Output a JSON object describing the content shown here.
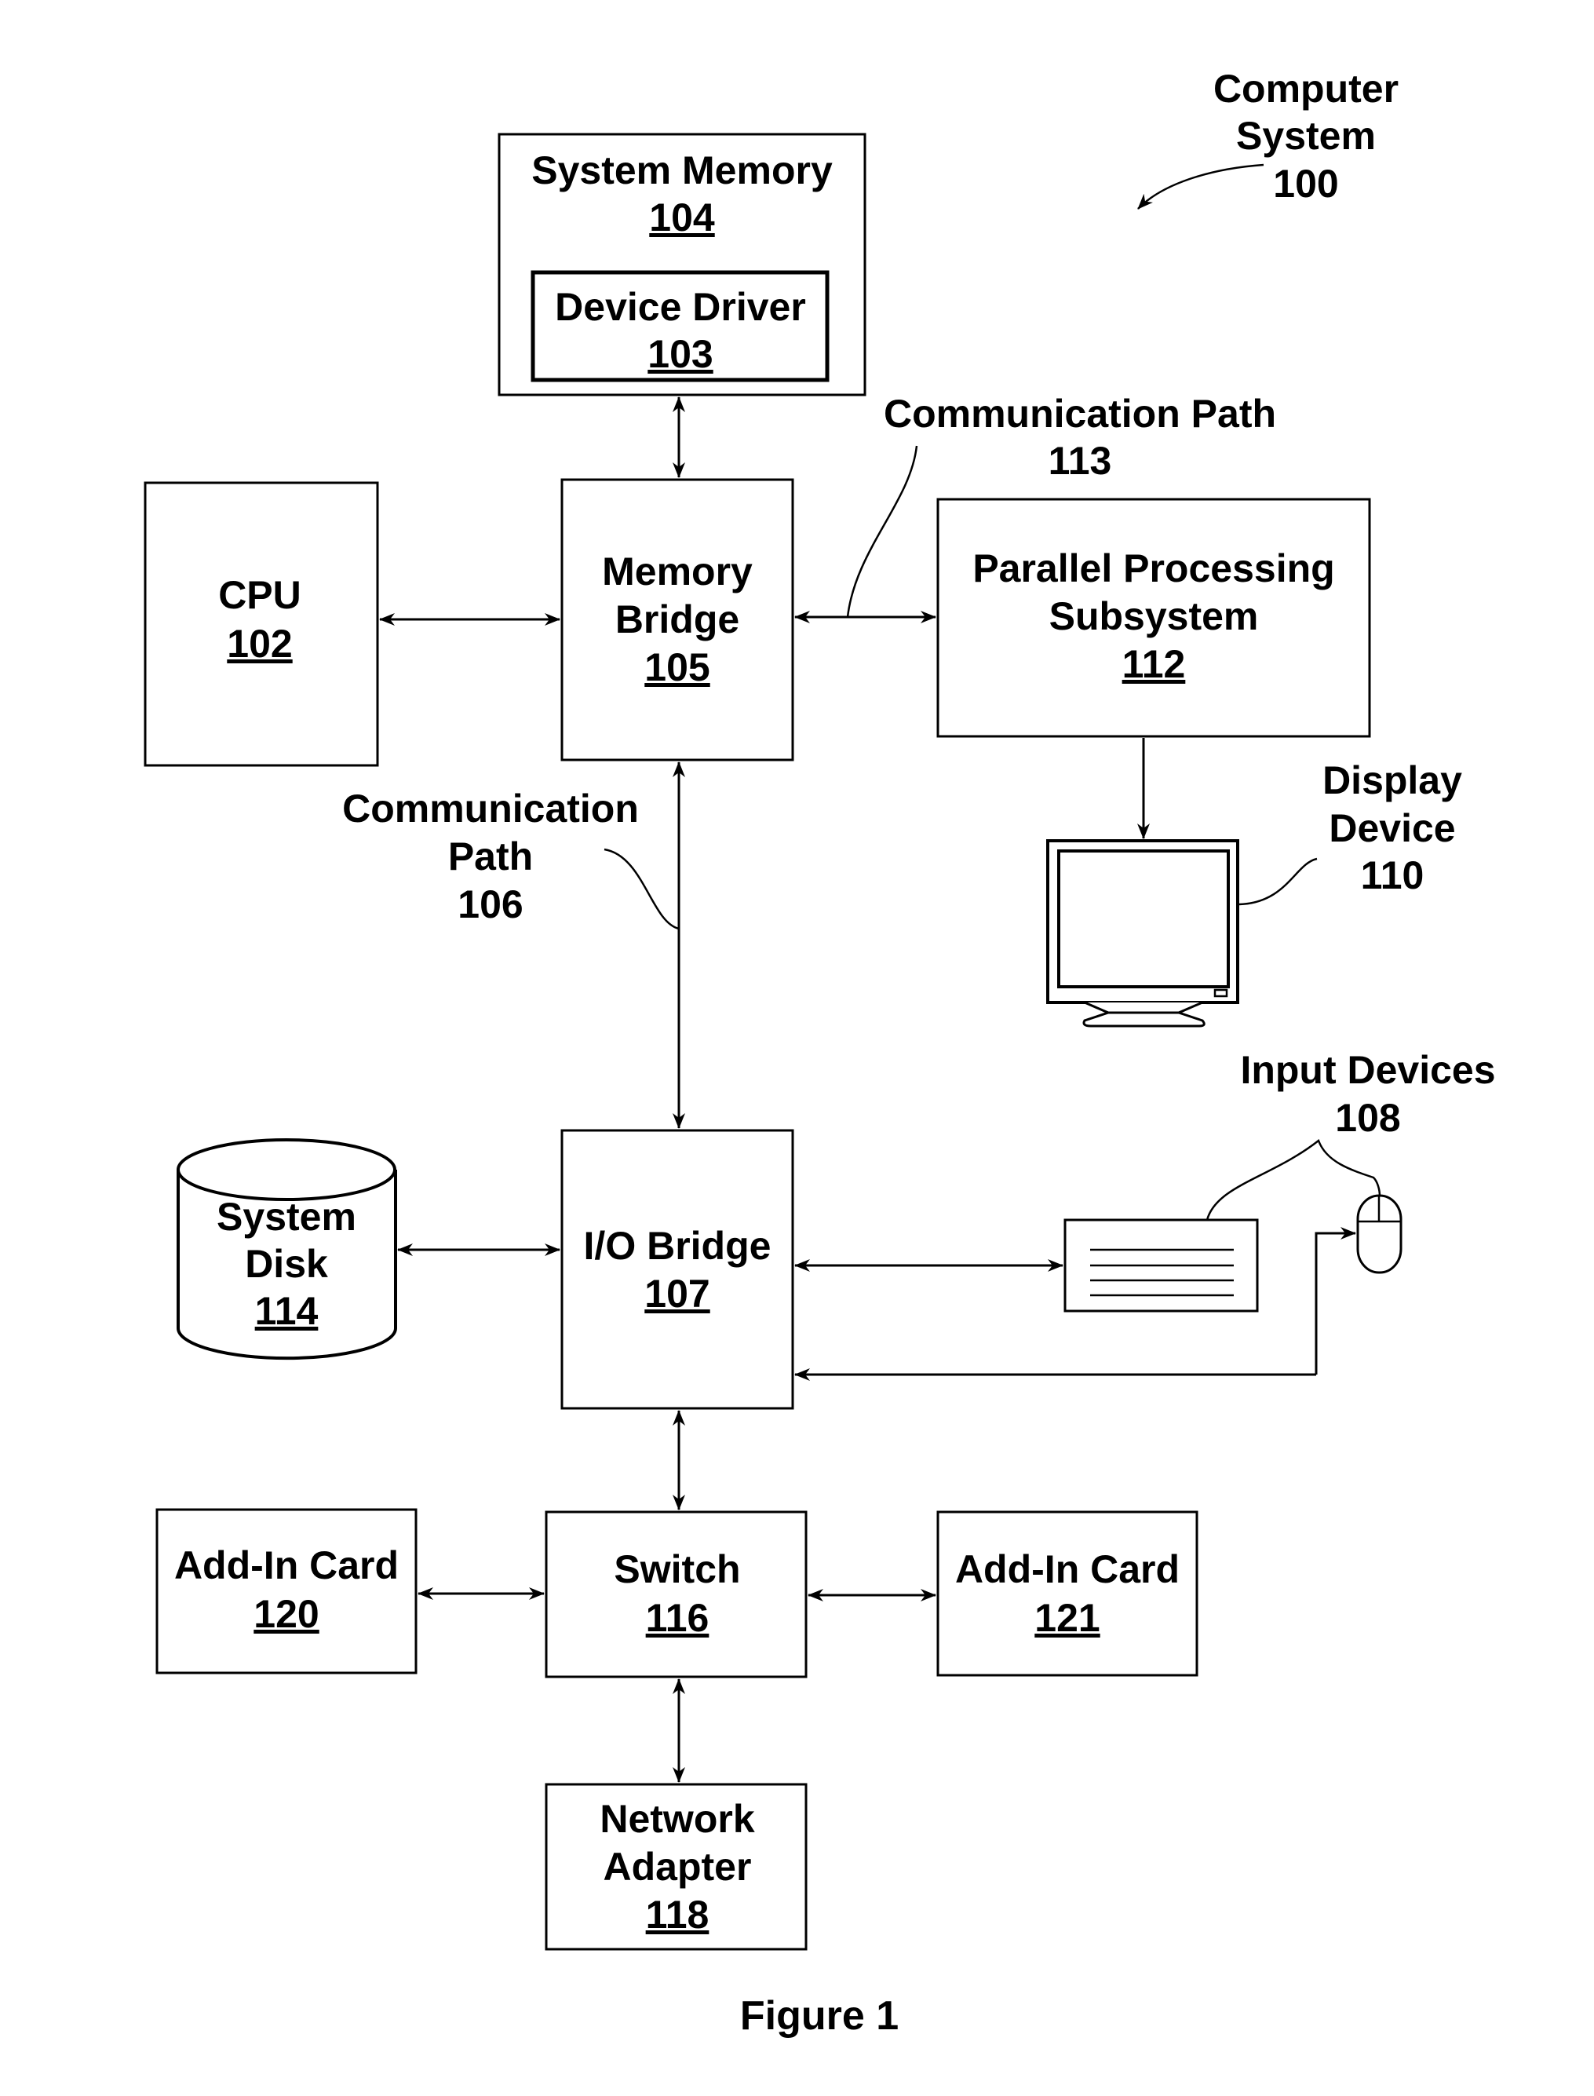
{
  "figure": {
    "caption": "Figure 1",
    "system_label": [
      "Computer",
      "System",
      "100"
    ]
  },
  "blocks": {
    "system_memory": {
      "name": "System Memory",
      "ref": "104"
    },
    "device_driver": {
      "name": "Device Driver",
      "ref": "103"
    },
    "cpu": {
      "name": "CPU",
      "ref": "102"
    },
    "memory_bridge": {
      "name": [
        "Memory",
        "Bridge"
      ],
      "ref": "105"
    },
    "parallel_processing": {
      "name": [
        "Parallel Processing",
        "Subsystem"
      ],
      "ref": "112"
    },
    "display_device": {
      "name": [
        "Display",
        "Device"
      ],
      "ref": "110"
    },
    "io_bridge": {
      "name": "I/O Bridge",
      "ref": "107"
    },
    "system_disk": {
      "name": [
        "System",
        "Disk"
      ],
      "ref": "114"
    },
    "input_devices": {
      "name": "Input Devices",
      "ref": "108"
    },
    "switch": {
      "name": "Switch",
      "ref": "116"
    },
    "add_in_card_120": {
      "name": "Add-In Card",
      "ref": "120"
    },
    "add_in_card_121": {
      "name": "Add-In Card",
      "ref": "121"
    },
    "network_adapter": {
      "name": [
        "Network",
        "Adapter"
      ],
      "ref": "118"
    }
  },
  "paths": {
    "comm_path_113": {
      "name": "Communication Path",
      "ref": "113"
    },
    "comm_path_106": {
      "name": [
        "Communication",
        "Path"
      ],
      "ref": "106"
    }
  }
}
